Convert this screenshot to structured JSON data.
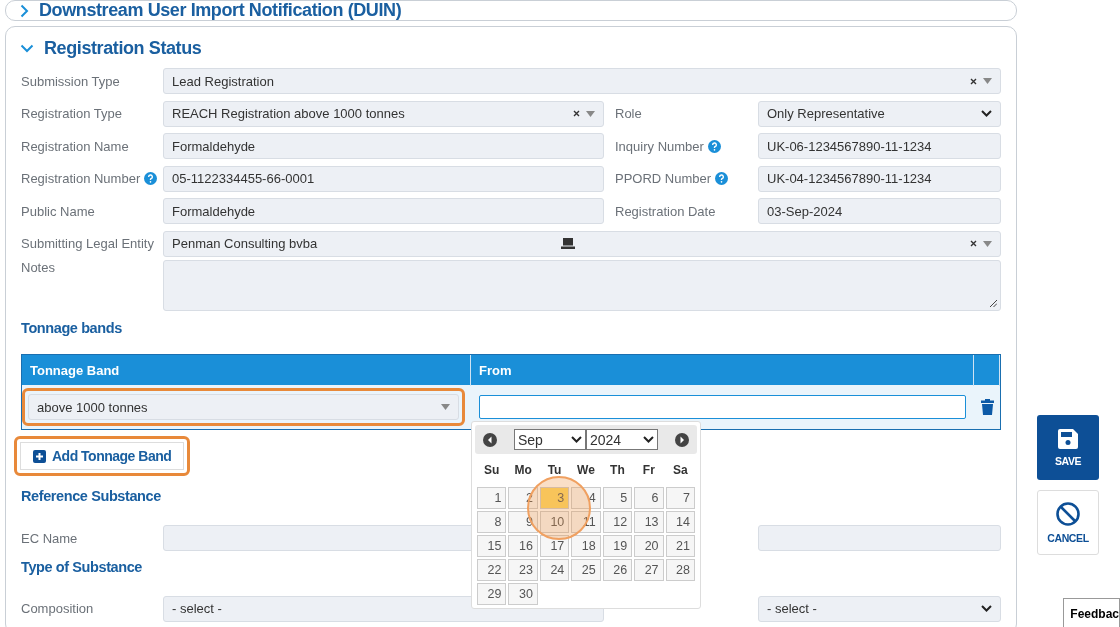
{
  "collapsed_section": {
    "title": "Downstream User Import Notification (DUIN)",
    "expanded": false
  },
  "section": {
    "title": "Registration Status",
    "expanded": true
  },
  "rows": [
    [
      {
        "kind": "combo",
        "label": "Submission Type",
        "value": "Lead Registration",
        "help": false
      }
    ],
    [
      {
        "kind": "combo",
        "label": "Registration Type",
        "value": "REACH Registration above 1000 tonnes",
        "help": false
      },
      {
        "kind": "select",
        "label": "Role",
        "value": "Only Representative",
        "help": false
      }
    ],
    [
      {
        "kind": "text",
        "label": "Registration Name",
        "value": "Formaldehyde",
        "help": false
      },
      {
        "kind": "text",
        "label": "Inquiry Number",
        "value": "UK-06-1234567890-11-1234",
        "help": true
      }
    ],
    [
      {
        "kind": "text",
        "label": "Registration Number",
        "value": "05-1122334455-66-0001",
        "help": true
      },
      {
        "kind": "text",
        "label": "PPORD Number",
        "value": "UK-04-1234567890-11-1234",
        "help": true
      }
    ],
    [
      {
        "kind": "text",
        "label": "Public Name",
        "value": "Formaldehyde",
        "help": false
      },
      {
        "kind": "text",
        "label": "Registration Date",
        "value": "03-Sep-2024",
        "help": false
      }
    ],
    [
      {
        "kind": "entity",
        "label": "Submitting Legal Entity",
        "value": "Penman Consulting bvba",
        "help": false
      }
    ],
    [
      {
        "kind": "textarea",
        "label": "Notes",
        "help": false
      }
    ]
  ],
  "tonnage": {
    "title": "Tonnage bands",
    "columns": [
      "Tonnage Band",
      "From"
    ],
    "rows": [
      {
        "band": "above 1000 tonnes"
      }
    ],
    "add_button": "Add Tonnage Band"
  },
  "calendar": {
    "month": "Sep",
    "year": "2024",
    "weekdays": [
      "Su",
      "Mo",
      "Tu",
      "We",
      "Th",
      "Fr",
      "Sa"
    ],
    "days": [
      {
        "label": "1",
        "selected": false
      },
      {
        "label": "2",
        "selected": false
      },
      {
        "label": "3",
        "selected": true
      },
      {
        "label": "4",
        "selected": false
      },
      {
        "label": "5",
        "selected": false
      },
      {
        "label": "6",
        "selected": false
      },
      {
        "label": "7",
        "selected": false
      },
      {
        "label": "8",
        "selected": false
      },
      {
        "label": "9",
        "selected": false
      },
      {
        "label": "10",
        "selected": false
      },
      {
        "label": "11",
        "selected": false
      },
      {
        "label": "12",
        "selected": false
      },
      {
        "label": "13",
        "selected": false
      },
      {
        "label": "14",
        "selected": false
      },
      {
        "label": "15",
        "selected": false
      },
      {
        "label": "16",
        "selected": false
      },
      {
        "label": "17",
        "selected": false
      },
      {
        "label": "18",
        "selected": false
      },
      {
        "label": "19",
        "selected": false
      },
      {
        "label": "20",
        "selected": false
      },
      {
        "label": "21",
        "selected": false
      },
      {
        "label": "22",
        "selected": false
      },
      {
        "label": "23",
        "selected": false
      },
      {
        "label": "24",
        "selected": false
      },
      {
        "label": "25",
        "selected": false
      },
      {
        "label": "26",
        "selected": false
      },
      {
        "label": "27",
        "selected": false
      },
      {
        "label": "28",
        "selected": false
      },
      {
        "label": "29",
        "selected": false
      },
      {
        "label": "30",
        "selected": false
      }
    ]
  },
  "reference": {
    "title": "Reference Substance",
    "rows": [
      [
        {
          "kind": "text",
          "label": "EC Name",
          "help": false
        },
        {
          "kind": "text"
        }
      ]
    ]
  },
  "substance_type": {
    "title": "Type of Substance",
    "rows": [
      [
        {
          "kind": "plainselect",
          "label": "Composition",
          "value": "- select -",
          "help": false
        },
        {
          "kind": "select",
          "value": "- select -"
        }
      ]
    ]
  },
  "actions": {
    "save": "SAVE",
    "cancel": "CANCEL"
  },
  "feedback": "Feedbac"
}
